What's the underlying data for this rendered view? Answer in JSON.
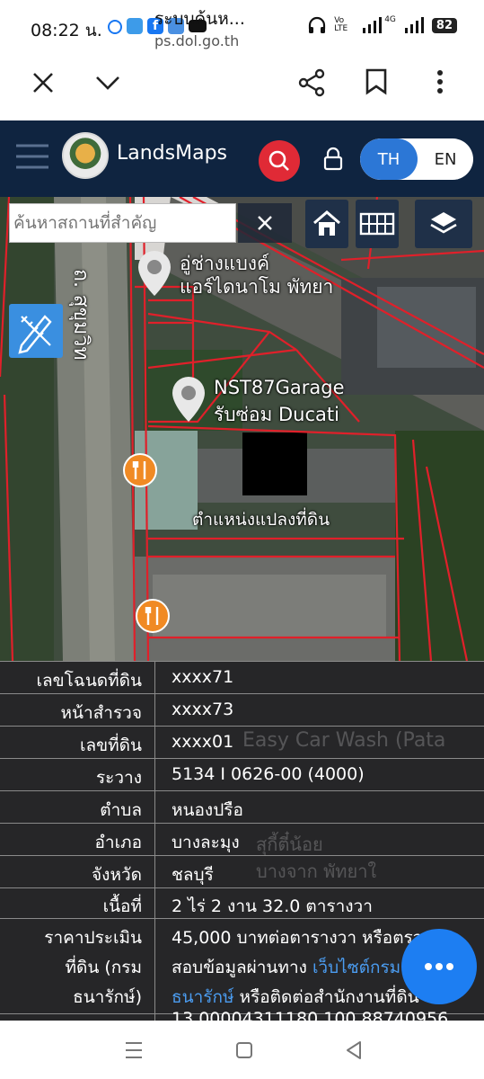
{
  "status_bar": {
    "time": "08:22 น.",
    "network": "Vo LTE",
    "signal": "4G",
    "battery": "82"
  },
  "browser": {
    "page_title": "ระบบค้นห...",
    "url": "ps.dol.go.th"
  },
  "app": {
    "title": "LandsMaps",
    "lang_th": "TH",
    "lang_en": "EN"
  },
  "map": {
    "search_placeholder": "ค้นหาสถานที่สำคัญ",
    "road_label": "ถ. สุขุมวิท",
    "poi_1": "อู่ช่างแบงค์",
    "poi_1b": "แอร์ไดนาโม พัทยา",
    "poi_2": "NST87Garage",
    "poi_2b": "รับซ่อม Ducati",
    "parcel_label": "ตำแหน่งแปลงที่ดิน",
    "bg_1": "Easy Car Wash (Pata",
    "bg_2": "สุกี้ตี๋น้อย",
    "bg_3": "บางจาก พัทยาใ"
  },
  "parcel": {
    "rows": [
      {
        "label": "เลขโฉนดที่ดิน",
        "value": "xxxx71"
      },
      {
        "label": "หน้าสำรวจ",
        "value": "xxxx73"
      },
      {
        "label": "เลขที่ดิน",
        "value": "xxxx01"
      },
      {
        "label": "ระวาง",
        "value": "5134 I 0626-00 (4000)"
      },
      {
        "label": "ตำบล",
        "value": "หนองปรือ"
      },
      {
        "label": "อำเภอ",
        "value": "บางละมุง"
      },
      {
        "label": "จังหวัด",
        "value": "ชลบุรี"
      },
      {
        "label": "เนื้อที่",
        "value": "2 ไร่ 2 งาน 32.0 ตารางวา"
      }
    ],
    "price_label_1": "ราคาประเมิน",
    "price_label_2": "ที่ดิน (กรม",
    "price_label_3": "ธนารักษ์)",
    "price_line_1": "45,000 บาทต่อตารางวา หรือตรวจ",
    "price_line_2a": "สอบข้อมูลผ่านทาง ",
    "price_line_2b": "เว็บไซต์กรม",
    "price_line_3a": "ธนารักษ์",
    "price_line_3b": " หรือติดต่อสำนักงานที่ดิน",
    "coords_partial": "13.00004311180,100.88740956"
  },
  "colors": {
    "header_bg": "#0f2440",
    "search_red": "#e02a36",
    "accent_blue": "#2c77d6",
    "parcel_line": "#e0202a",
    "link": "#4b9cf0"
  }
}
